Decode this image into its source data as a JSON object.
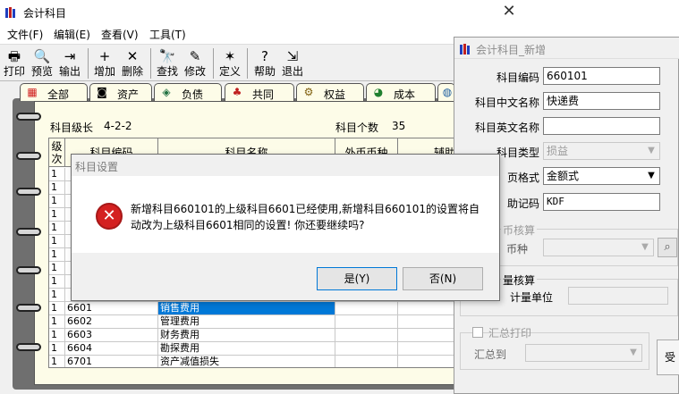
{
  "main_window": {
    "title": "会计科目",
    "close_glyph": "✕",
    "icon": "accounting-books-icon"
  },
  "menu": [
    "文件(F)",
    "编辑(E)",
    "查看(V)",
    "工具(T)"
  ],
  "toolbar": [
    {
      "label": "打印",
      "icon": "printer-icon",
      "glyph": "🖶"
    },
    {
      "label": "预览",
      "icon": "preview-icon",
      "glyph": "🔍"
    },
    {
      "label": "输出",
      "icon": "export-icon",
      "glyph": "⇥"
    },
    {
      "label": "增加",
      "icon": "add-icon",
      "glyph": "+"
    },
    {
      "label": "删除",
      "icon": "delete-icon",
      "glyph": "✕"
    },
    {
      "label": "查找",
      "icon": "find-icon",
      "glyph": "🔭"
    },
    {
      "label": "修改",
      "icon": "edit-icon",
      "glyph": "✎"
    },
    {
      "label": "定义",
      "icon": "define-wand-icon",
      "glyph": "✶"
    },
    {
      "label": "帮助",
      "icon": "help-icon",
      "glyph": "?"
    },
    {
      "label": "退出",
      "icon": "exit-door-icon",
      "glyph": "⇲"
    }
  ],
  "tabs": [
    {
      "label": "全部",
      "icon": "all-colorful-icon",
      "glyph": "▦"
    },
    {
      "label": "资产",
      "icon": "asset-icon",
      "glyph": "◙"
    },
    {
      "label": "负债",
      "icon": "liability-icon",
      "glyph": "◈"
    },
    {
      "label": "共同",
      "icon": "common-person-icon",
      "glyph": "♣"
    },
    {
      "label": "权益",
      "icon": "equity-gears-icon",
      "glyph": "⚙"
    },
    {
      "label": "成本",
      "icon": "cost-chart-icon",
      "glyph": "◕"
    },
    {
      "label": "",
      "icon": "profit-globe-icon",
      "glyph": "◍"
    }
  ],
  "summary": {
    "grade_label": "科目级长",
    "grade_value": "4-2-2",
    "count_label": "科目个数",
    "count_value": "35"
  },
  "grid": {
    "headers": {
      "level": "级次",
      "code": "科目编码",
      "name": "科目名称",
      "fx": "外币币种",
      "aux": "辅助核算"
    },
    "rows": [
      {
        "level": "1",
        "code": "",
        "name": ""
      },
      {
        "level": "1",
        "code": "",
        "name": ""
      },
      {
        "level": "1",
        "code": "",
        "name": ""
      },
      {
        "level": "1",
        "code": "",
        "name": ""
      },
      {
        "level": "1",
        "code": "",
        "name": ""
      },
      {
        "level": "1",
        "code": "",
        "name": ""
      },
      {
        "level": "1",
        "code": "",
        "name": ""
      },
      {
        "level": "1",
        "code": "",
        "name": ""
      },
      {
        "level": "1",
        "code": "",
        "name": ""
      },
      {
        "level": "1",
        "code": "",
        "name": ""
      },
      {
        "level": "1",
        "code": "6601",
        "name": "销售费用",
        "selected": true
      },
      {
        "level": "1",
        "code": "6602",
        "name": "管理费用"
      },
      {
        "level": "1",
        "code": "6603",
        "name": "财务费用"
      },
      {
        "level": "1",
        "code": "6604",
        "name": "勘探费用"
      },
      {
        "level": "1",
        "code": "6701",
        "name": "资产减值损失"
      }
    ]
  },
  "new_window": {
    "title": "会计科目_新增",
    "icon": "accounting-books-icon",
    "code_label": "科目编码",
    "code_value": "660101",
    "cn_label": "科目中文名称",
    "cn_value": "快递费",
    "en_label": "科目英文名称",
    "en_value": "",
    "type_label": "科目类型",
    "type_value": "损益",
    "format_label": "页格式",
    "format_value": "金额式",
    "mnemonic_label": "助记码",
    "mnemonic_value": "KDF",
    "fx_group": "币核算",
    "fx_currency_label": "币种",
    "qty_group": "量核算",
    "qty_unit_label": "计量单位",
    "summary_print_label": "汇总打印",
    "summary_to_label": "汇总到",
    "confirm_partial": "受"
  },
  "dialog": {
    "title": "科目设置",
    "message": "新增科目660101的上级科目6601已经使用,新增科目660101的设置将自动改为上级科目6601相同的设置! 你还要继续吗?",
    "yes_label": "是(Y)",
    "no_label": "否(N)",
    "icon": "error-icon",
    "close_glyph": "✕"
  },
  "colors": {
    "selection": "#0078d7",
    "page": "#fdfce8",
    "error": "#d42020"
  }
}
